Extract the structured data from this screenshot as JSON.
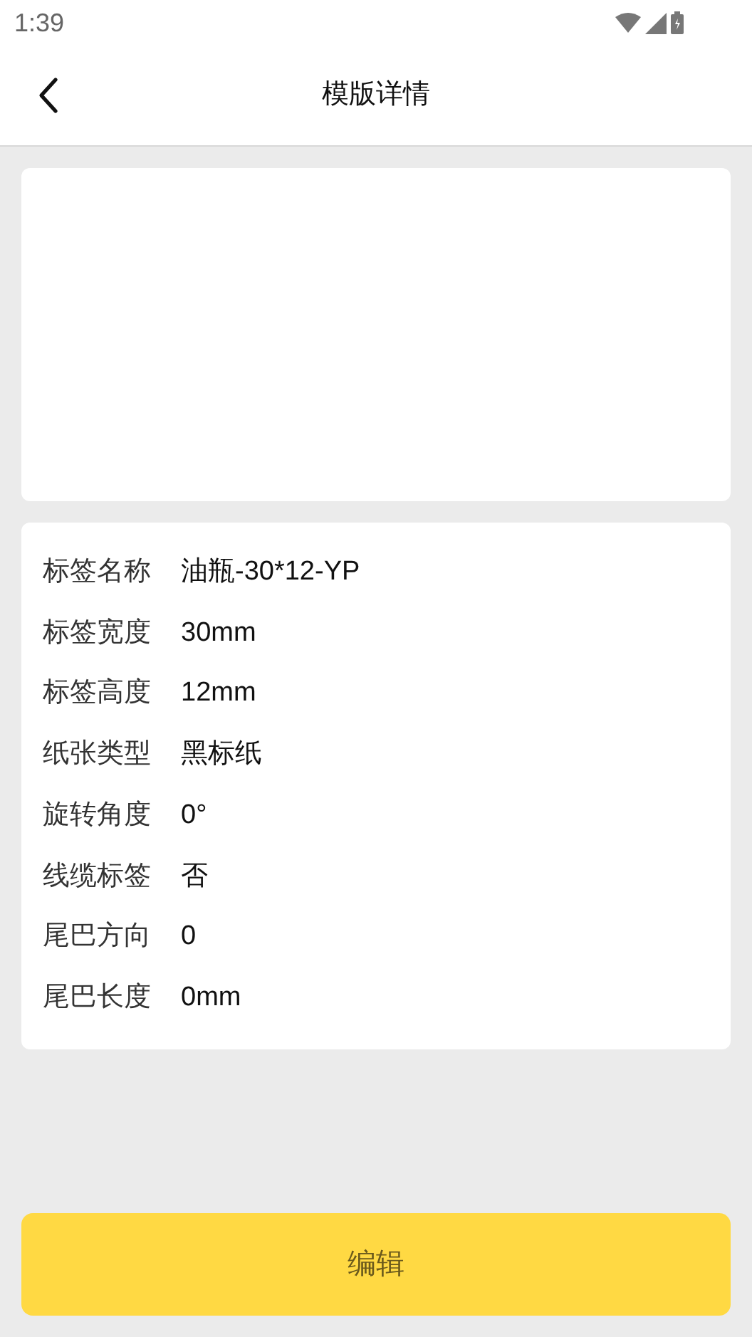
{
  "status_bar": {
    "time": "1:39"
  },
  "header": {
    "title": "模版详情"
  },
  "details": [
    {
      "label": "标签名称",
      "value": "油瓶-30*12-YP"
    },
    {
      "label": "标签宽度",
      "value": "30mm"
    },
    {
      "label": "标签高度",
      "value": "12mm"
    },
    {
      "label": "纸张类型",
      "value": "黑标纸"
    },
    {
      "label": "旋转角度",
      "value": "0°"
    },
    {
      "label": "线缆标签",
      "value": "否"
    },
    {
      "label": "尾巴方向",
      "value": "0"
    },
    {
      "label": "尾巴长度",
      "value": "0mm"
    }
  ],
  "edit_button": {
    "label": "编辑"
  }
}
